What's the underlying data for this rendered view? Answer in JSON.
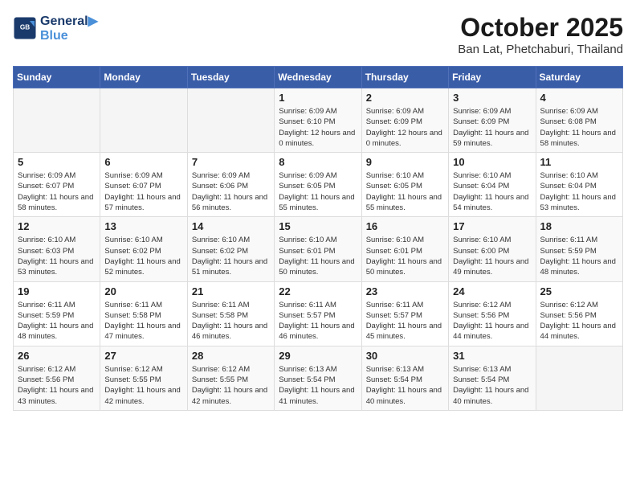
{
  "header": {
    "logo_line1": "General",
    "logo_line2": "Blue",
    "month_title": "October 2025",
    "location": "Ban Lat, Phetchaburi, Thailand"
  },
  "weekdays": [
    "Sunday",
    "Monday",
    "Tuesday",
    "Wednesday",
    "Thursday",
    "Friday",
    "Saturday"
  ],
  "weeks": [
    [
      {
        "day": "",
        "sunrise": "",
        "sunset": "",
        "daylight": ""
      },
      {
        "day": "",
        "sunrise": "",
        "sunset": "",
        "daylight": ""
      },
      {
        "day": "",
        "sunrise": "",
        "sunset": "",
        "daylight": ""
      },
      {
        "day": "1",
        "sunrise": "Sunrise: 6:09 AM",
        "sunset": "Sunset: 6:10 PM",
        "daylight": "Daylight: 12 hours and 0 minutes."
      },
      {
        "day": "2",
        "sunrise": "Sunrise: 6:09 AM",
        "sunset": "Sunset: 6:09 PM",
        "daylight": "Daylight: 12 hours and 0 minutes."
      },
      {
        "day": "3",
        "sunrise": "Sunrise: 6:09 AM",
        "sunset": "Sunset: 6:09 PM",
        "daylight": "Daylight: 11 hours and 59 minutes."
      },
      {
        "day": "4",
        "sunrise": "Sunrise: 6:09 AM",
        "sunset": "Sunset: 6:08 PM",
        "daylight": "Daylight: 11 hours and 58 minutes."
      }
    ],
    [
      {
        "day": "5",
        "sunrise": "Sunrise: 6:09 AM",
        "sunset": "Sunset: 6:07 PM",
        "daylight": "Daylight: 11 hours and 58 minutes."
      },
      {
        "day": "6",
        "sunrise": "Sunrise: 6:09 AM",
        "sunset": "Sunset: 6:07 PM",
        "daylight": "Daylight: 11 hours and 57 minutes."
      },
      {
        "day": "7",
        "sunrise": "Sunrise: 6:09 AM",
        "sunset": "Sunset: 6:06 PM",
        "daylight": "Daylight: 11 hours and 56 minutes."
      },
      {
        "day": "8",
        "sunrise": "Sunrise: 6:09 AM",
        "sunset": "Sunset: 6:05 PM",
        "daylight": "Daylight: 11 hours and 55 minutes."
      },
      {
        "day": "9",
        "sunrise": "Sunrise: 6:10 AM",
        "sunset": "Sunset: 6:05 PM",
        "daylight": "Daylight: 11 hours and 55 minutes."
      },
      {
        "day": "10",
        "sunrise": "Sunrise: 6:10 AM",
        "sunset": "Sunset: 6:04 PM",
        "daylight": "Daylight: 11 hours and 54 minutes."
      },
      {
        "day": "11",
        "sunrise": "Sunrise: 6:10 AM",
        "sunset": "Sunset: 6:04 PM",
        "daylight": "Daylight: 11 hours and 53 minutes."
      }
    ],
    [
      {
        "day": "12",
        "sunrise": "Sunrise: 6:10 AM",
        "sunset": "Sunset: 6:03 PM",
        "daylight": "Daylight: 11 hours and 53 minutes."
      },
      {
        "day": "13",
        "sunrise": "Sunrise: 6:10 AM",
        "sunset": "Sunset: 6:02 PM",
        "daylight": "Daylight: 11 hours and 52 minutes."
      },
      {
        "day": "14",
        "sunrise": "Sunrise: 6:10 AM",
        "sunset": "Sunset: 6:02 PM",
        "daylight": "Daylight: 11 hours and 51 minutes."
      },
      {
        "day": "15",
        "sunrise": "Sunrise: 6:10 AM",
        "sunset": "Sunset: 6:01 PM",
        "daylight": "Daylight: 11 hours and 50 minutes."
      },
      {
        "day": "16",
        "sunrise": "Sunrise: 6:10 AM",
        "sunset": "Sunset: 6:01 PM",
        "daylight": "Daylight: 11 hours and 50 minutes."
      },
      {
        "day": "17",
        "sunrise": "Sunrise: 6:10 AM",
        "sunset": "Sunset: 6:00 PM",
        "daylight": "Daylight: 11 hours and 49 minutes."
      },
      {
        "day": "18",
        "sunrise": "Sunrise: 6:11 AM",
        "sunset": "Sunset: 5:59 PM",
        "daylight": "Daylight: 11 hours and 48 minutes."
      }
    ],
    [
      {
        "day": "19",
        "sunrise": "Sunrise: 6:11 AM",
        "sunset": "Sunset: 5:59 PM",
        "daylight": "Daylight: 11 hours and 48 minutes."
      },
      {
        "day": "20",
        "sunrise": "Sunrise: 6:11 AM",
        "sunset": "Sunset: 5:58 PM",
        "daylight": "Daylight: 11 hours and 47 minutes."
      },
      {
        "day": "21",
        "sunrise": "Sunrise: 6:11 AM",
        "sunset": "Sunset: 5:58 PM",
        "daylight": "Daylight: 11 hours and 46 minutes."
      },
      {
        "day": "22",
        "sunrise": "Sunrise: 6:11 AM",
        "sunset": "Sunset: 5:57 PM",
        "daylight": "Daylight: 11 hours and 46 minutes."
      },
      {
        "day": "23",
        "sunrise": "Sunrise: 6:11 AM",
        "sunset": "Sunset: 5:57 PM",
        "daylight": "Daylight: 11 hours and 45 minutes."
      },
      {
        "day": "24",
        "sunrise": "Sunrise: 6:12 AM",
        "sunset": "Sunset: 5:56 PM",
        "daylight": "Daylight: 11 hours and 44 minutes."
      },
      {
        "day": "25",
        "sunrise": "Sunrise: 6:12 AM",
        "sunset": "Sunset: 5:56 PM",
        "daylight": "Daylight: 11 hours and 44 minutes."
      }
    ],
    [
      {
        "day": "26",
        "sunrise": "Sunrise: 6:12 AM",
        "sunset": "Sunset: 5:56 PM",
        "daylight": "Daylight: 11 hours and 43 minutes."
      },
      {
        "day": "27",
        "sunrise": "Sunrise: 6:12 AM",
        "sunset": "Sunset: 5:55 PM",
        "daylight": "Daylight: 11 hours and 42 minutes."
      },
      {
        "day": "28",
        "sunrise": "Sunrise: 6:12 AM",
        "sunset": "Sunset: 5:55 PM",
        "daylight": "Daylight: 11 hours and 42 minutes."
      },
      {
        "day": "29",
        "sunrise": "Sunrise: 6:13 AM",
        "sunset": "Sunset: 5:54 PM",
        "daylight": "Daylight: 11 hours and 41 minutes."
      },
      {
        "day": "30",
        "sunrise": "Sunrise: 6:13 AM",
        "sunset": "Sunset: 5:54 PM",
        "daylight": "Daylight: 11 hours and 40 minutes."
      },
      {
        "day": "31",
        "sunrise": "Sunrise: 6:13 AM",
        "sunset": "Sunset: 5:54 PM",
        "daylight": "Daylight: 11 hours and 40 minutes."
      },
      {
        "day": "",
        "sunrise": "",
        "sunset": "",
        "daylight": ""
      }
    ]
  ]
}
